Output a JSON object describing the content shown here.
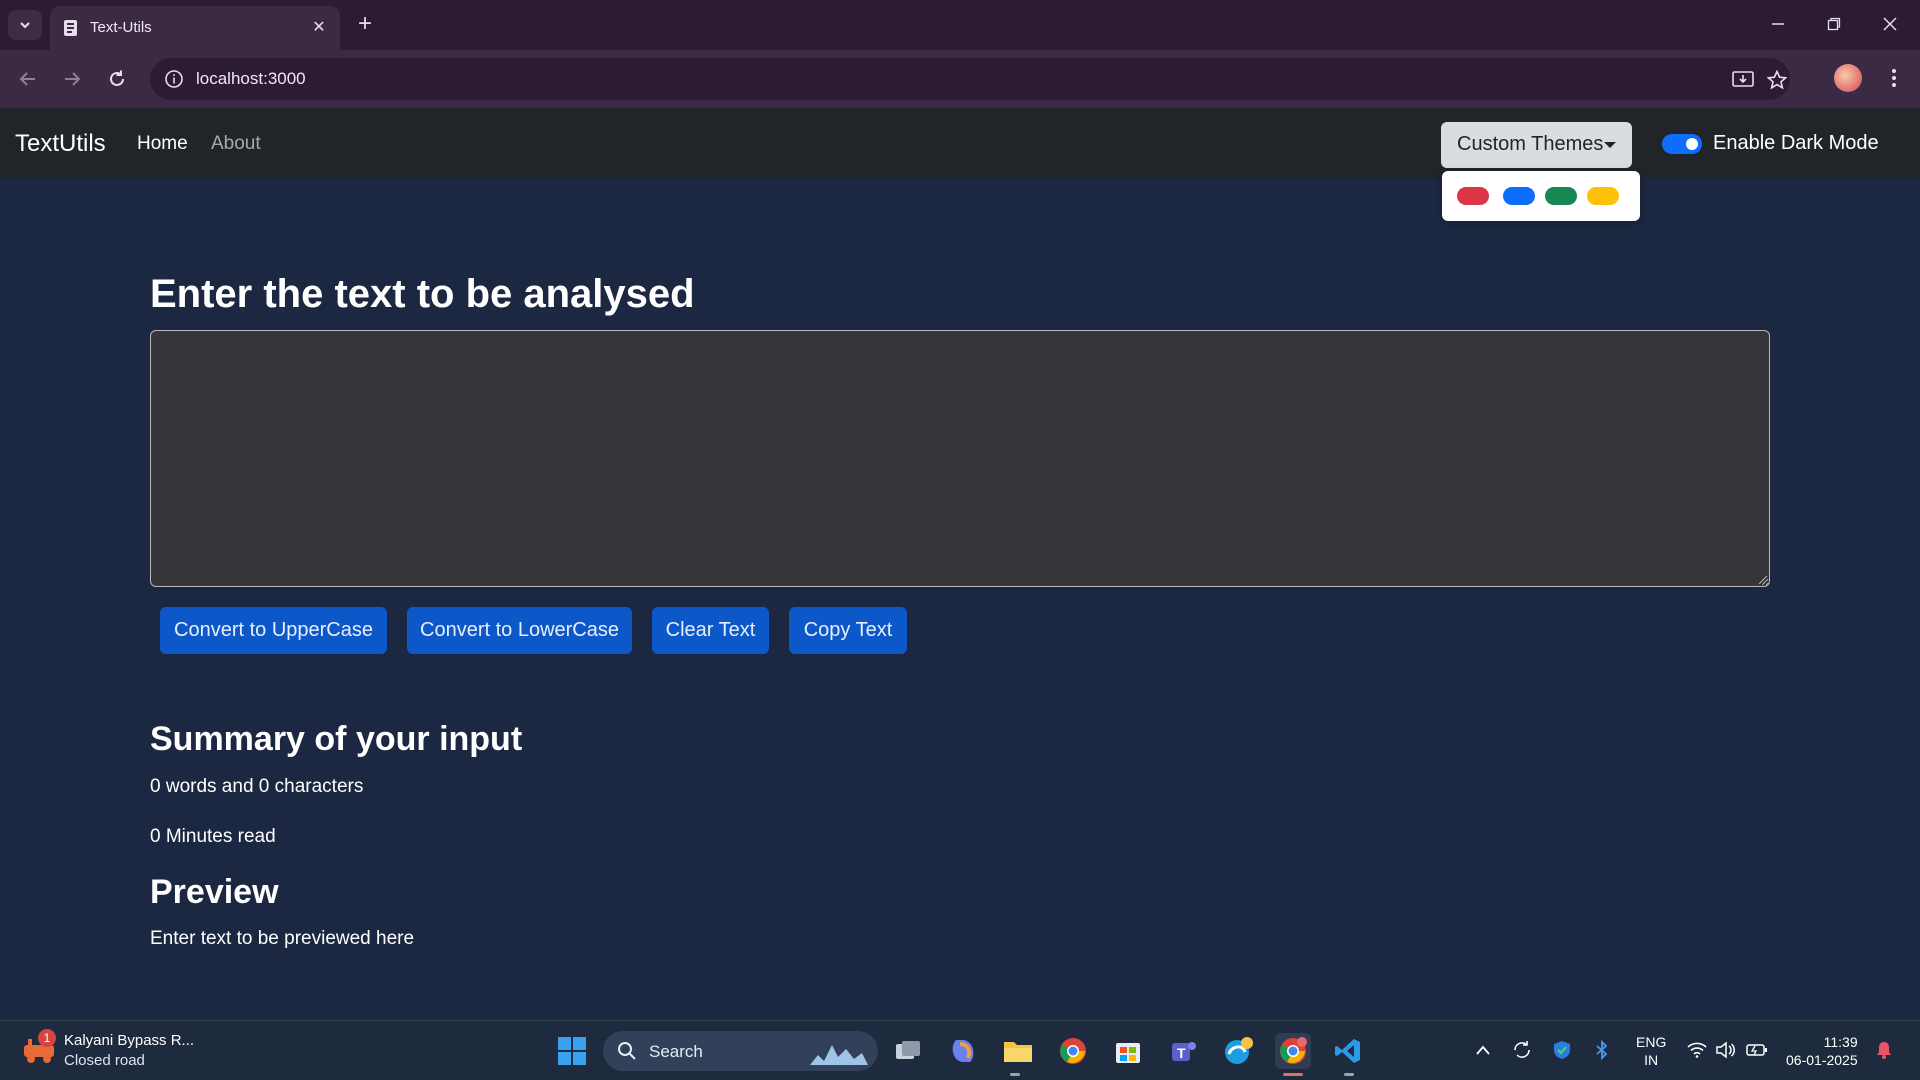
{
  "browser": {
    "tab_title": "Text-Utils",
    "url": "localhost:3000"
  },
  "navbar": {
    "brand": "TextUtils",
    "links": [
      "Home",
      "About"
    ],
    "themes_button": "Custom Themes",
    "dark_mode_label": "Enable Dark Mode",
    "dark_mode_enabled": true
  },
  "theme_options": [
    {
      "name": "red",
      "color": "#dc3545"
    },
    {
      "name": "blue",
      "color": "#0d6efd"
    },
    {
      "name": "green",
      "color": "#198754"
    },
    {
      "name": "yellow",
      "color": "#ffc107"
    }
  ],
  "main": {
    "heading": "Enter the text to be analysed",
    "textarea_value": "",
    "buttons": [
      "Convert to UpperCase",
      "Convert to LowerCase",
      "Clear Text",
      "Copy Text"
    ],
    "summary_heading": "Summary of your input",
    "word_count_text": "0 words and 0 characters",
    "read_time_text": "0 Minutes read",
    "preview_heading": "Preview",
    "preview_text": "Enter text to be previewed here"
  },
  "taskbar": {
    "weather_title": "Kalyani Bypass R...",
    "weather_subtitle": "Closed road",
    "weather_badge": "1",
    "search_label": "Search",
    "lang_line1": "ENG",
    "lang_line2": "IN",
    "time": "11:39",
    "date": "06-01-2025"
  },
  "colors": {
    "page_bg": "#1c2841",
    "navbar_bg": "#212529",
    "button_bg": "#0d58c8",
    "textarea_bg": "#363539"
  }
}
